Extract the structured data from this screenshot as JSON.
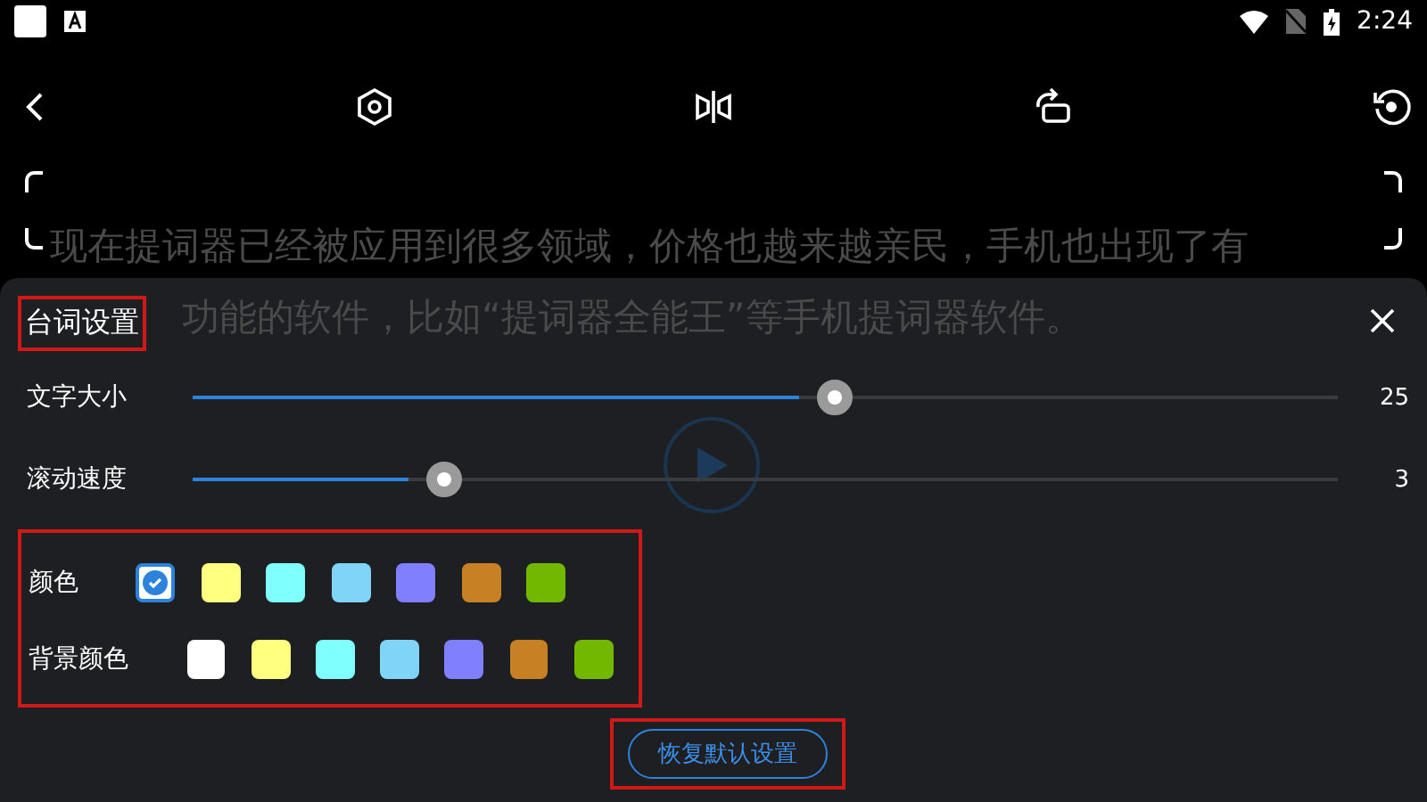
{
  "status_bar": {
    "time": "2:24"
  },
  "prompt_text": {
    "lines": [
      "现在提词器已经被应用到很多领域，价格也越来越亲民，手机也出现了有",
      "功能的软件，比如“提词器全能王”等手机提词器软件。"
    ]
  },
  "settings_sheet": {
    "title": "台词设置",
    "sliders": [
      {
        "label": "文字大小",
        "level": 0.56,
        "reading": "25"
      },
      {
        "label": "滚动速度",
        "level": 0.22,
        "reading": "3"
      }
    ],
    "text_color": {
      "label": "颜色",
      "swatches": [
        {
          "color": "#ffffff",
          "selected": true
        },
        {
          "color": "#ffff80",
          "selected": false
        },
        {
          "color": "#80ffff",
          "selected": false
        },
        {
          "color": "#80d4f8",
          "selected": false
        },
        {
          "color": "#8080ff",
          "selected": false
        },
        {
          "color": "#c88024",
          "selected": false
        },
        {
          "color": "#72b800",
          "selected": false
        }
      ]
    },
    "background_color": {
      "label": "背景颜色",
      "swatches": [
        {
          "color": "#ffffff",
          "selected": false
        },
        {
          "color": "#ffff80",
          "selected": false
        },
        {
          "color": "#80ffff",
          "selected": false
        },
        {
          "color": "#80d4f8",
          "selected": false
        },
        {
          "color": "#8080ff",
          "selected": false
        },
        {
          "color": "#c88024",
          "selected": false
        },
        {
          "color": "#72b800",
          "selected": false
        }
      ]
    },
    "reset_button": "恢复默认设置"
  }
}
